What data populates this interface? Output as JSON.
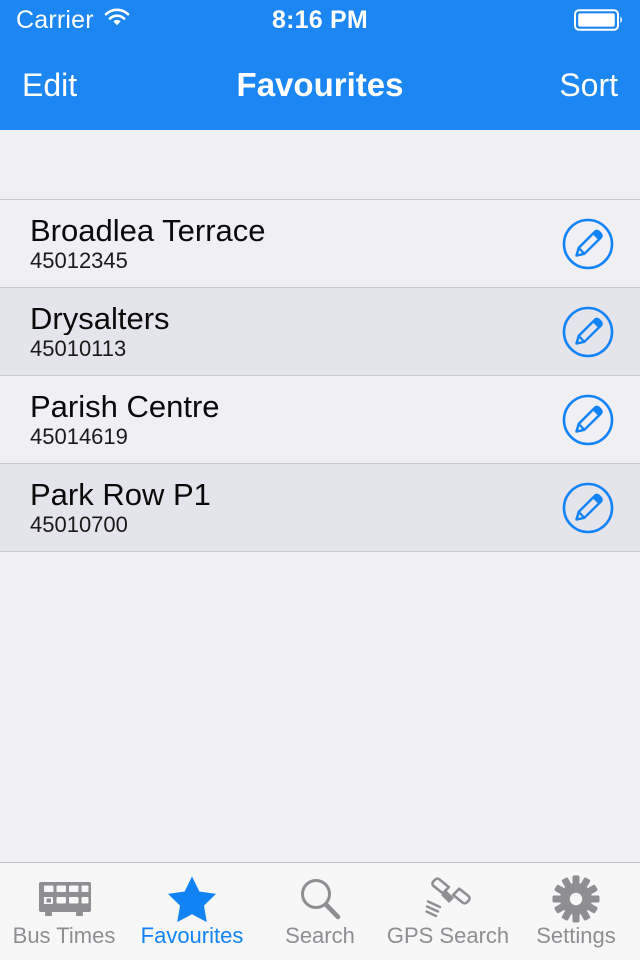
{
  "status_bar": {
    "carrier": "Carrier",
    "wifi_icon": "wifi-icon",
    "time": "8:16 PM",
    "battery_icon": "battery-full-icon"
  },
  "nav_bar": {
    "left_button": "Edit",
    "title": "Favourites",
    "right_button": "Sort"
  },
  "colors": {
    "nav_background": "#1C86F2",
    "accent": "#1283F5",
    "row_background": "#EFEFF4",
    "row_background_alt": "#E4E4EC",
    "separator": "#C9C9CE",
    "tab_inactive": "#8E8E93",
    "tabbar_background": "#F7F7F7"
  },
  "favourites": [
    {
      "name": "Broadlea Terrace",
      "code": "45012345",
      "accessory_icon": "edit-pencil-circle-icon"
    },
    {
      "name": "Drysalters",
      "code": "45010113",
      "accessory_icon": "edit-pencil-circle-icon"
    },
    {
      "name": "Parish Centre",
      "code": "45014619",
      "accessory_icon": "edit-pencil-circle-icon"
    },
    {
      "name": "Park Row P1",
      "code": "45010700",
      "accessory_icon": "edit-pencil-circle-icon"
    }
  ],
  "tab_bar": {
    "tabs": [
      {
        "label": "Bus Times",
        "icon": "bus-icon",
        "active": false
      },
      {
        "label": "Favourites",
        "icon": "star-icon",
        "active": true
      },
      {
        "label": "Search",
        "icon": "magnifier-icon",
        "active": false
      },
      {
        "label": "GPS Search",
        "icon": "satellite-icon",
        "active": false
      },
      {
        "label": "Settings",
        "icon": "gear-icon",
        "active": false
      }
    ]
  }
}
